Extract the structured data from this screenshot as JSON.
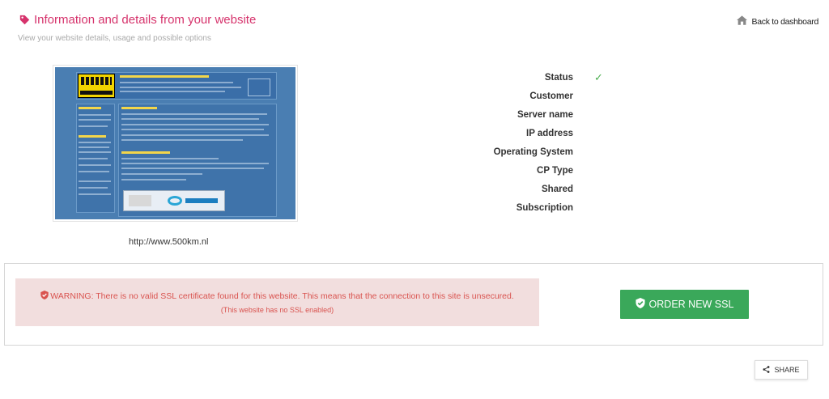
{
  "header": {
    "title": "Information and details from your website",
    "subtitle": "View your website details, usage and possible options",
    "back_label": "Back to dashboard",
    "accent_color": "#d6336c"
  },
  "website": {
    "url": "http://www.500km.nl",
    "screenshot_logo_text": "500km.nl"
  },
  "details": {
    "fields": [
      {
        "label": "Status",
        "value": "✓"
      },
      {
        "label": "Customer",
        "value": ""
      },
      {
        "label": "Server name",
        "value": ""
      },
      {
        "label": "IP address",
        "value": ""
      },
      {
        "label": "Operating System",
        "value": ""
      },
      {
        "label": "CP Type",
        "value": ""
      },
      {
        "label": "Shared",
        "value": ""
      },
      {
        "label": "Subscription",
        "value": ""
      }
    ]
  },
  "ssl": {
    "warning_prefix": "WARNING:",
    "warning_text": "There is no valid SSL certificate found for this website. This means that the connection to this site is unsecured.",
    "warning_note": "(This website has no SSL enabled)",
    "order_label": "ORDER NEW SSL",
    "warning_bg": "#f2dede",
    "warning_color": "#d9534f",
    "button_color": "#3aa85a"
  },
  "share": {
    "label": "SHARE"
  }
}
